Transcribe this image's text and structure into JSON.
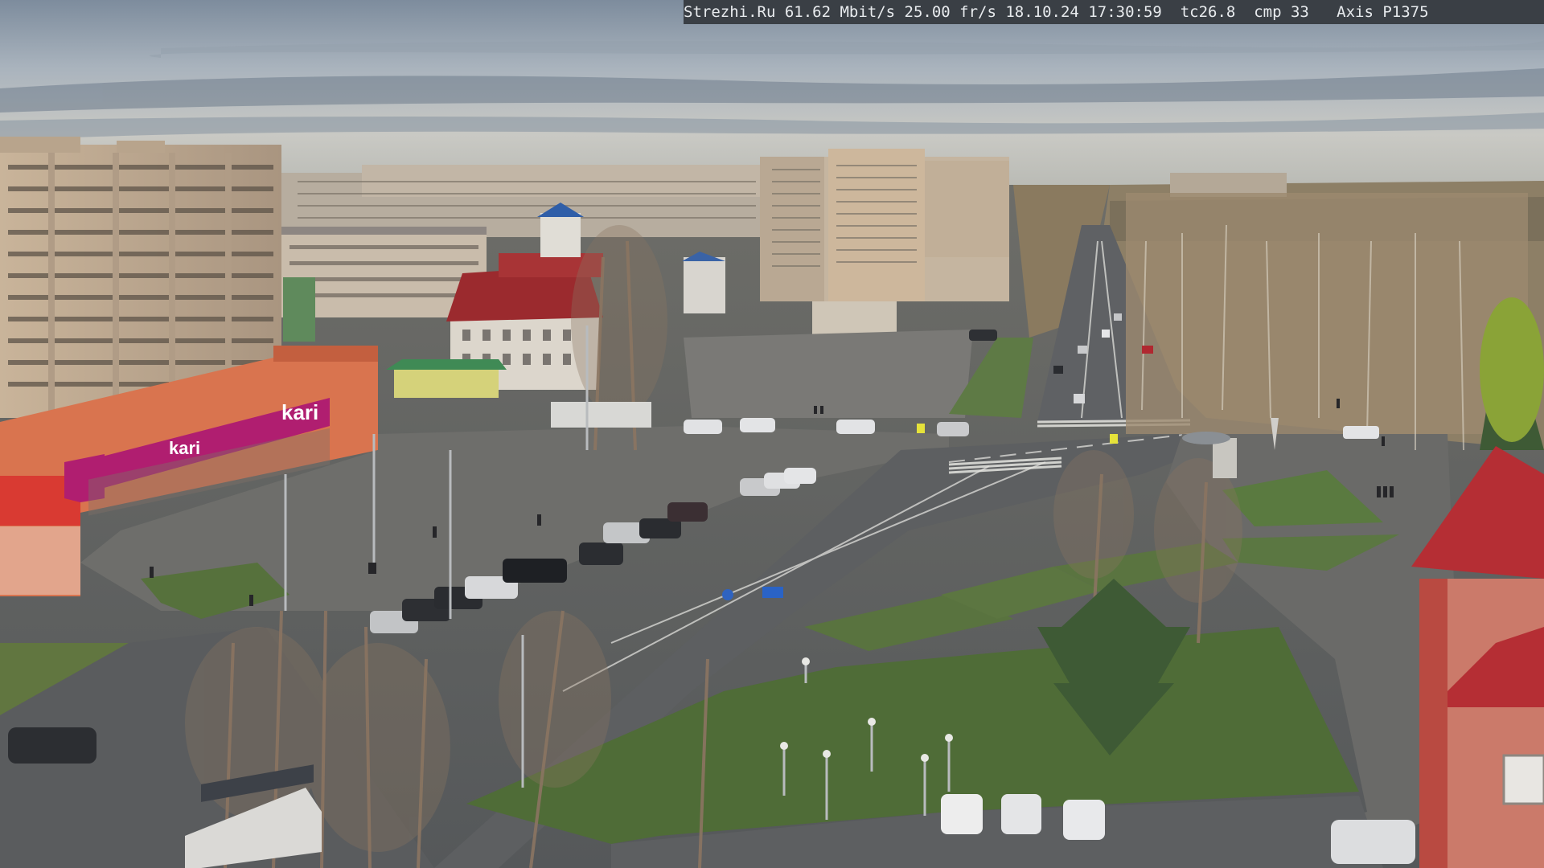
{
  "overlay": {
    "text": "Strezhi.Ru 61.62 Mbit/s 25.00 fr/s 18.10.24 17:30:59  tc26.8  cmp 33   Axis P1375"
  },
  "signs": {
    "store_kari_roof": "kari",
    "store_kari_front": "kari"
  }
}
